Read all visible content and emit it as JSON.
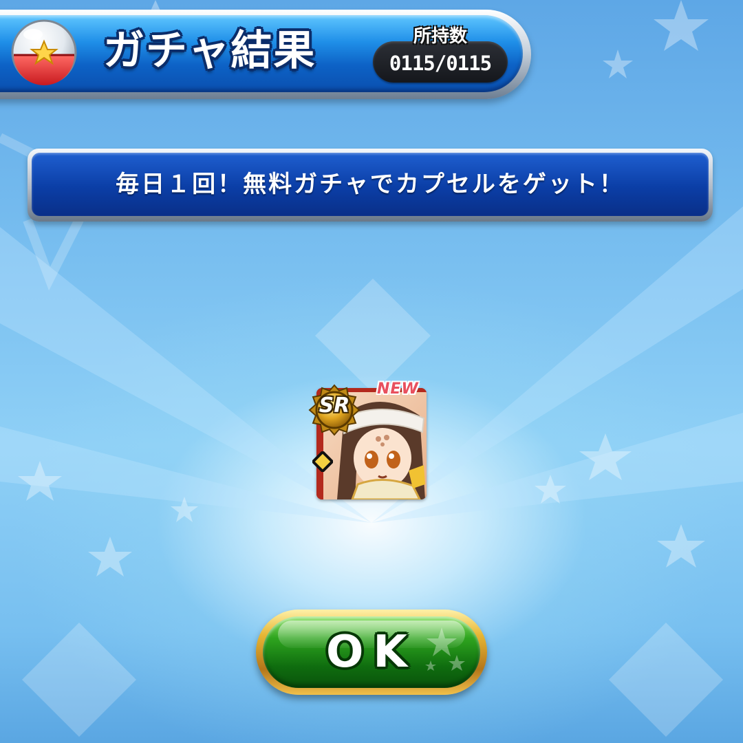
{
  "header": {
    "title": "ガチャ結果",
    "count_label": "所持数",
    "count_value": "0115/0115",
    "icon": "capsule-icon"
  },
  "banner": {
    "text": "毎日１回！無料ガチャでカプセルをゲット！"
  },
  "result": {
    "rarity": "SR",
    "new_label": "NEW",
    "icon": "character-portrait"
  },
  "actions": {
    "ok_label": "OK"
  },
  "colors": {
    "header_blue": "#1f8fe8",
    "banner_blue": "#0b3ea6",
    "ok_green": "#2fa51f",
    "ok_gold": "#e7b634",
    "background": "#79bff0"
  }
}
